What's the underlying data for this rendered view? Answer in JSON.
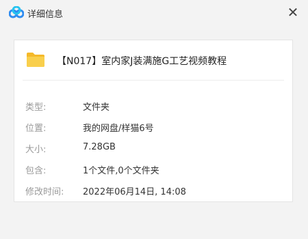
{
  "window": {
    "title": "详细信息",
    "close_label": "✕"
  },
  "file": {
    "name": "【N017】室内家J装满施G工艺视频教程",
    "icon": "folder-icon"
  },
  "details": [
    {
      "label": "类型:",
      "value": "文件夹"
    },
    {
      "label": "位置:",
      "value": "我的网盘/样猫6号"
    },
    {
      "label": "大小:",
      "value": "7.28GB"
    },
    {
      "label": "包含:",
      "value": "1个文件,0个文件夹"
    },
    {
      "label": "修改时间:",
      "value": "2022年06月14日, 14:08"
    }
  ],
  "colors": {
    "folder": "#f7c948",
    "logo_blue": "#2f8cf0"
  }
}
